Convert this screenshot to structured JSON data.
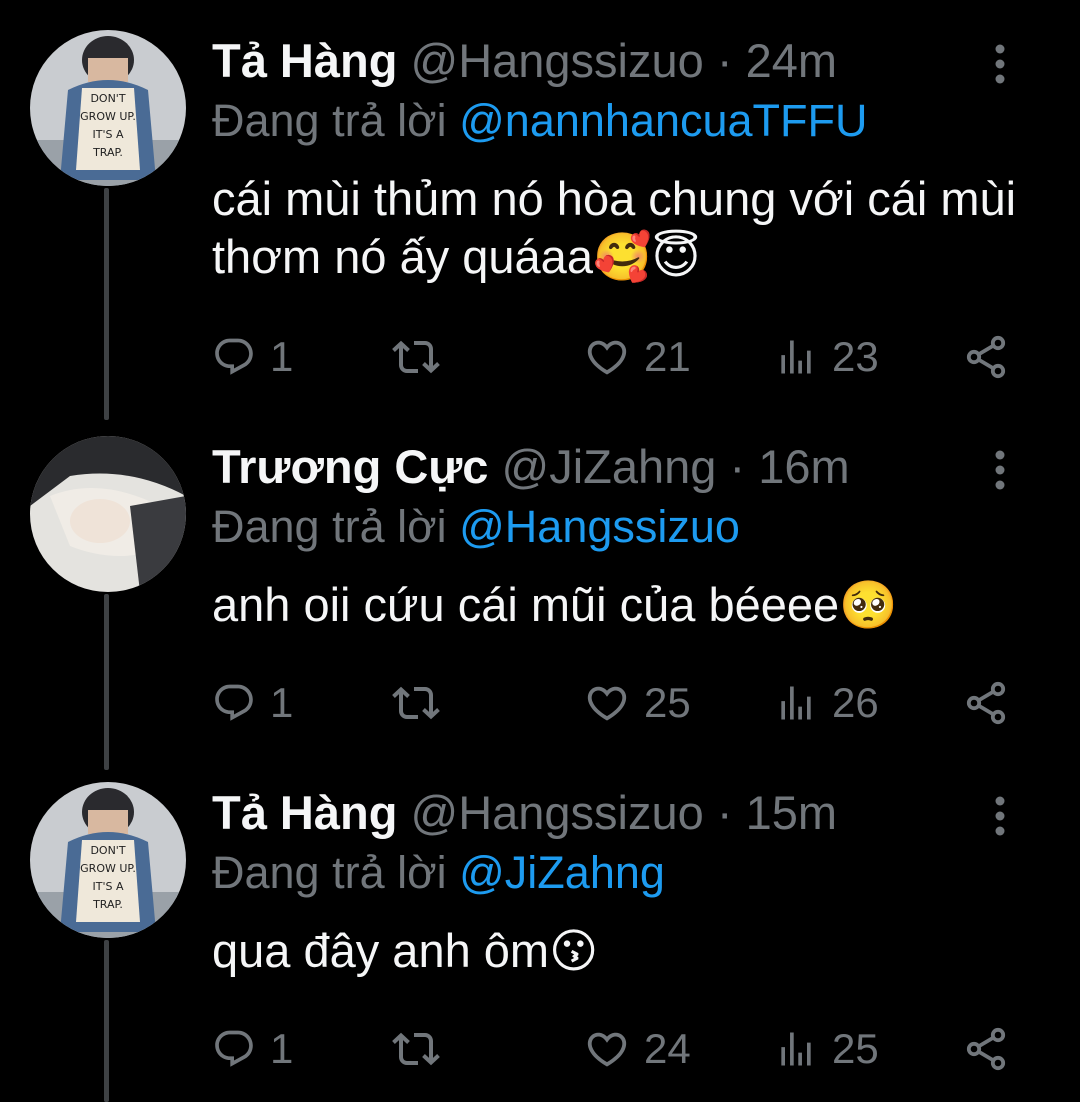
{
  "colors": {
    "background": "#000000",
    "text": "#f5f6f7",
    "muted": "#71767b",
    "accent": "#1d9bf0",
    "thread_line": "#3e4144"
  },
  "tweets": [
    {
      "display_name": "Tả Hàng",
      "handle": "@Hangssizuo",
      "separator": "·",
      "time": "24m",
      "reply_prefix": "Đang trả lời",
      "reply_to": "@nannhancuaTFFU",
      "text": "cái mùi thủm nó hòa chung với cái mùi thơm nó ấy quáaa",
      "emojis": "🥰😇",
      "avatar_icon": "avatar-photo",
      "avatar_shirt_text": "DON'T GROW UP. IT'S A TRAP.",
      "replies": "1",
      "retweets": "",
      "likes": "21",
      "views": "23"
    },
    {
      "display_name": "Trương Cực",
      "handle": "@JiZahng",
      "separator": "·",
      "time": "16m",
      "reply_prefix": "Đang trả lời",
      "reply_to": "@Hangssizuo",
      "text": "anh oii cứu cái mũi của béeee",
      "emojis": "🥺",
      "avatar_icon": "avatar-photo",
      "replies": "1",
      "retweets": "",
      "likes": "25",
      "views": "26"
    },
    {
      "display_name": "Tả Hàng",
      "handle": "@Hangssizuo",
      "separator": "·",
      "time": "15m",
      "reply_prefix": "Đang trả lời",
      "reply_to": "@JiZahng",
      "text": "qua đây anh ôm",
      "emojis": "😗",
      "avatar_icon": "avatar-photo",
      "avatar_shirt_text": "DON'T GROW UP. IT'S A TRAP.",
      "replies": "1",
      "retweets": "",
      "likes": "24",
      "views": "25"
    }
  ]
}
